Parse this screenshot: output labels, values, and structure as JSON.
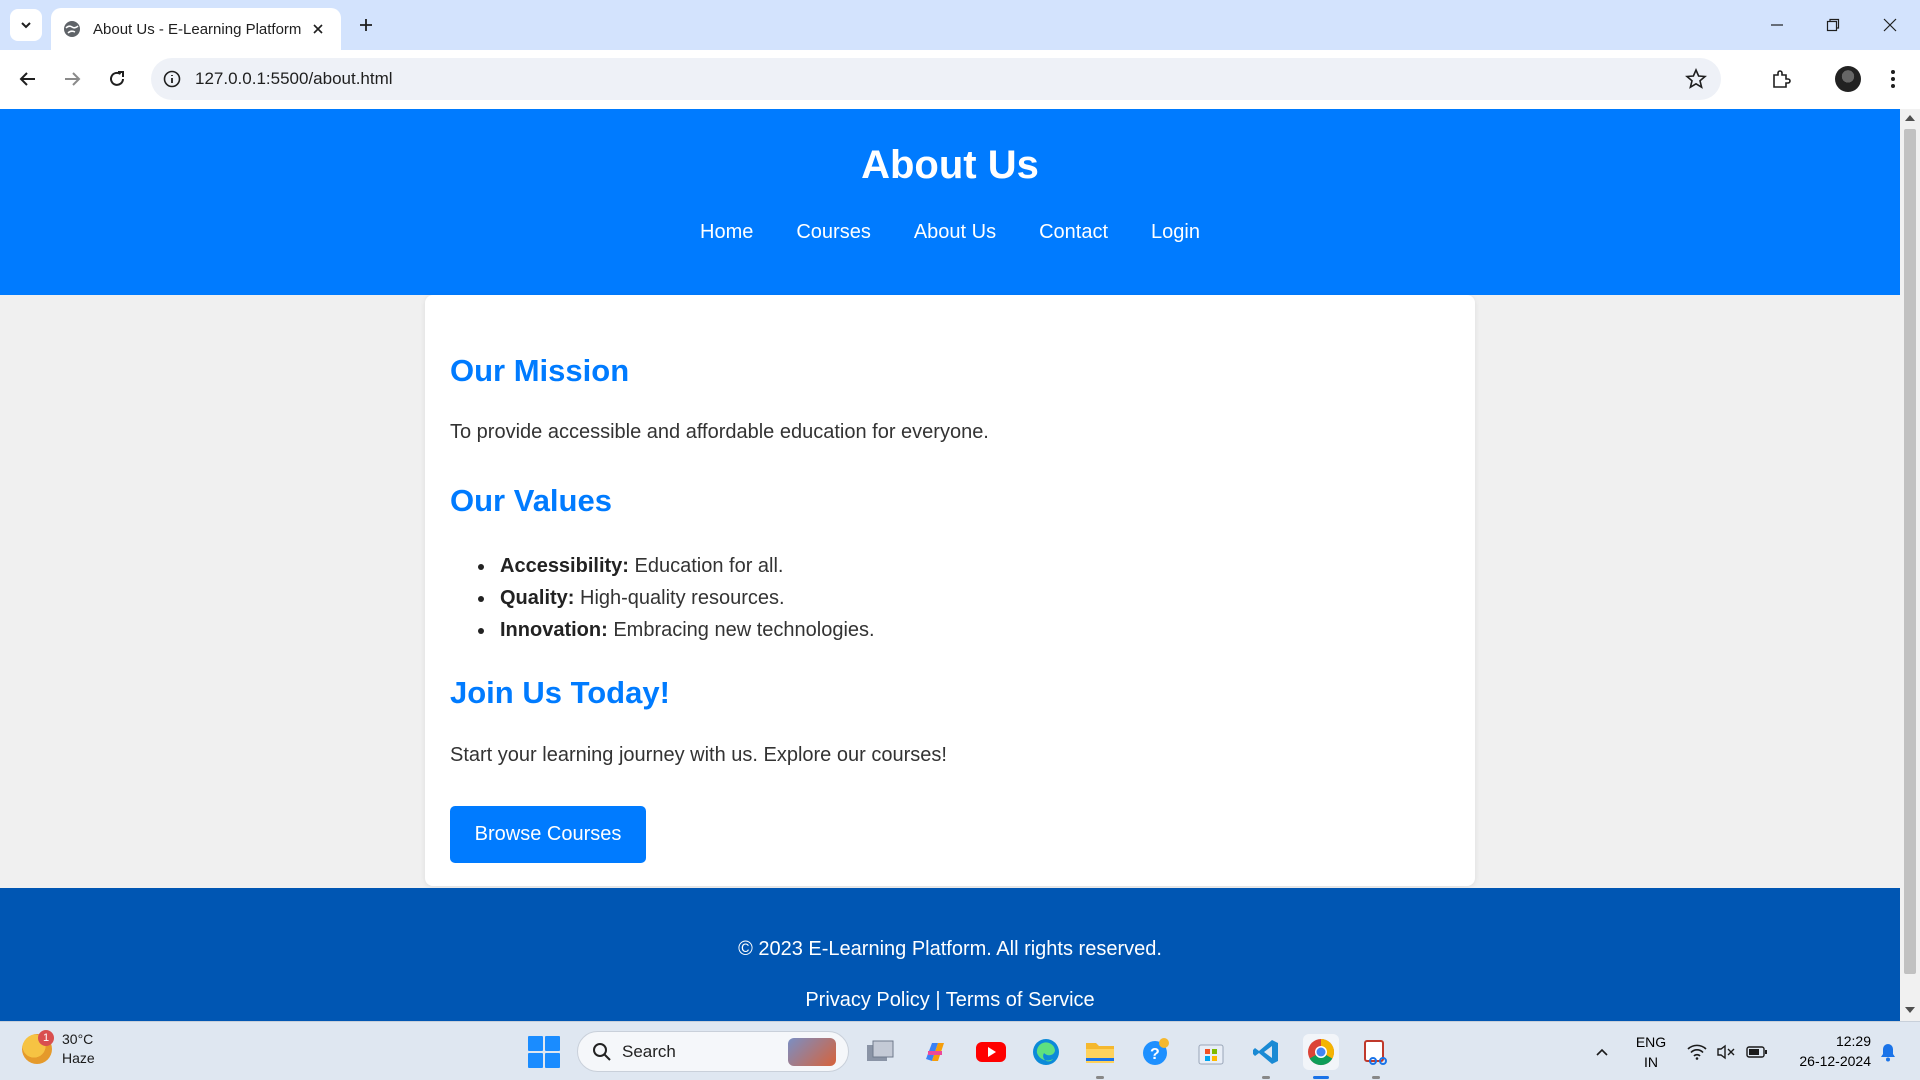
{
  "browser": {
    "tab_title": "About Us - E-Learning Platform",
    "url": "127.0.0.1:5500/about.html"
  },
  "site": {
    "title": "About Us",
    "nav": [
      {
        "label": "Home"
      },
      {
        "label": "Courses"
      },
      {
        "label": "About Us"
      },
      {
        "label": "Contact"
      },
      {
        "label": "Login"
      }
    ]
  },
  "content": {
    "mission_heading": "Our Mission",
    "mission_text": "To provide accessible and affordable education for everyone.",
    "values_heading": "Our Values",
    "values": [
      {
        "term": "Accessibility:",
        "text": " Education for all."
      },
      {
        "term": "Quality:",
        "text": " High-quality resources."
      },
      {
        "term": "Innovation:",
        "text": " Embracing new technologies."
      }
    ],
    "join_heading": "Join Us Today!",
    "join_text": "Start your learning journey with us. Explore our courses!",
    "browse_button": "Browse Courses"
  },
  "footer": {
    "copyright": "© 2023 E-Learning Platform. All rights reserved.",
    "privacy": "Privacy Policy",
    "separator": " | ",
    "terms": "Terms of Service"
  },
  "taskbar": {
    "weather_temp": "30°C",
    "weather_desc": "Haze",
    "weather_badge": "1",
    "search_label": "Search",
    "lang_top": "ENG",
    "lang_bottom": "IN",
    "time": "12:29",
    "date": "26-12-2024"
  },
  "colors": {
    "primary": "#007bff",
    "footer": "#0056b3",
    "page_bg": "#f0f0f0"
  }
}
